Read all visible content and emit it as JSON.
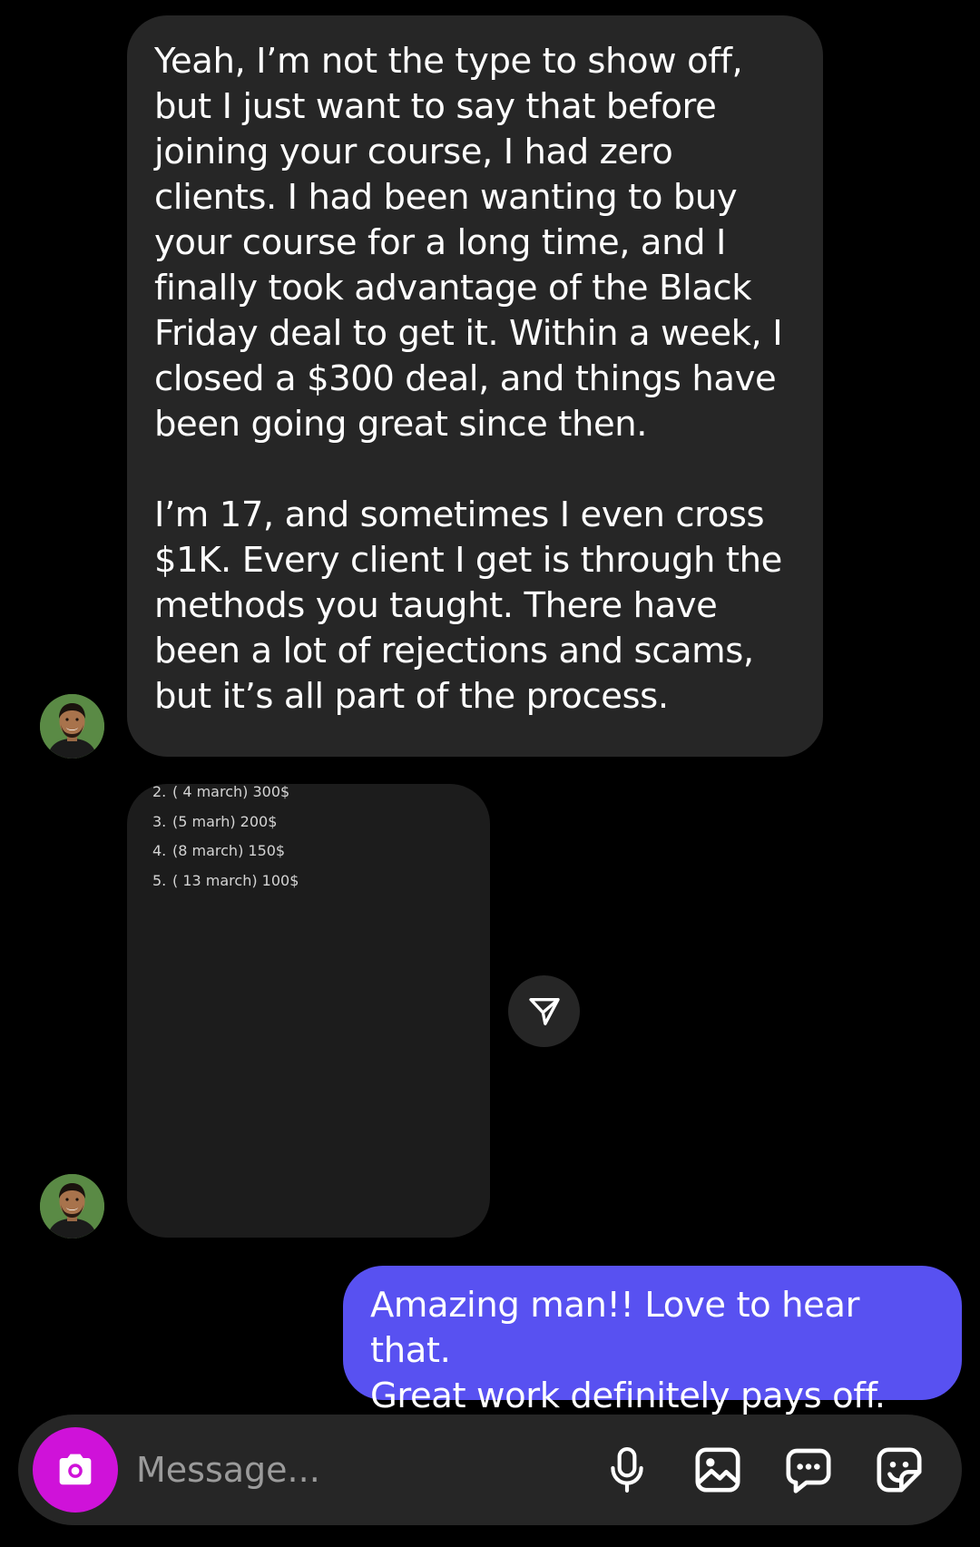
{
  "messages": {
    "incoming_1": {
      "paragraph_1": "Yeah, I’m not the type to show off, but I just want to say that before joining your course, I had zero clients. I had been wanting to buy your course for a long time, and I finally took advantage of the Black Friday deal to get it. Within a week, I closed a $300 deal, and things have been going great since then.",
      "paragraph_2": "I’m 17, and sometimes I even cross $1K. Every client I get is through the methods you taught. There have been a lot of rejections and scams, but it’s all part of the process."
    },
    "incoming_2_image": {
      "items": [
        {
          "num": "2.",
          "text": "( 4 march) 300$"
        },
        {
          "num": "3.",
          "text": "(5 marh) 200$"
        },
        {
          "num": "4.",
          "text": "(8 march) 150$"
        },
        {
          "num": "5.",
          "text": "( 13 march) 100$"
        }
      ]
    },
    "outgoing_1": {
      "line_1": "Amazing man!! Love to hear that.",
      "line_2": "Great work definitely pays off."
    }
  },
  "composer": {
    "placeholder": "Message...",
    "camera_icon": "camera-icon",
    "mic_icon": "microphone-icon",
    "gallery_icon": "image-icon",
    "chat_icon": "chat-bubble-icon",
    "sticker_icon": "sticker-icon"
  },
  "colors": {
    "incoming_bubble": "#262626",
    "outgoing_bubble": "#5851f1",
    "camera_button": "#cf12d9",
    "background": "#000000"
  }
}
